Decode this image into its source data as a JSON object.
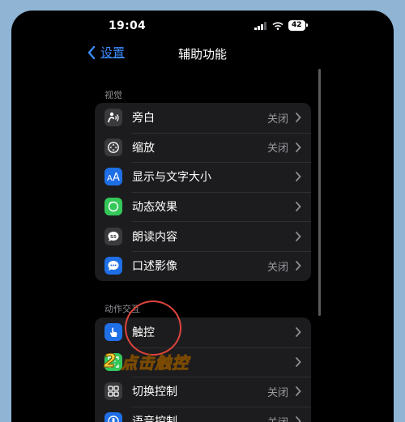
{
  "status_bar": {
    "time": "19:04",
    "battery": "42"
  },
  "nav": {
    "back_label": "设置",
    "title": "辅助功能"
  },
  "sections": {
    "vision": {
      "header": "视觉",
      "items": [
        {
          "label": "旁白",
          "value": "关闭",
          "icon": "voiceover-icon",
          "color": "#3a3a3c"
        },
        {
          "label": "缩放",
          "value": "关闭",
          "icon": "zoom-icon",
          "color": "#3a3a3c"
        },
        {
          "label": "显示与文字大小",
          "value": "",
          "icon": "text-size-icon",
          "color": "#1f6fe6"
        },
        {
          "label": "动态效果",
          "value": "",
          "icon": "motion-icon",
          "color": "#34c759"
        },
        {
          "label": "朗读内容",
          "value": "",
          "icon": "spoken-content-icon",
          "color": "#3a3a3c"
        },
        {
          "label": "口述影像",
          "value": "关闭",
          "icon": "audio-description-icon",
          "color": "#1f6fe6"
        }
      ]
    },
    "interaction": {
      "header": "动作交互",
      "items": [
        {
          "label": "触控",
          "value": "",
          "icon": "touch-icon",
          "color": "#1f6fe6"
        },
        {
          "label": "",
          "value": "",
          "icon": "face-id-icon",
          "color": "#34c759"
        },
        {
          "label": "切换控制",
          "value": "关闭",
          "icon": "switch-control-icon",
          "color": "#3a3a3c"
        },
        {
          "label": "语音控制",
          "value": "关闭",
          "icon": "voice-control-icon",
          "color": "#1f6fe6"
        }
      ]
    }
  },
  "annotation": {
    "step_number": "2",
    "text": "点击触控"
  }
}
